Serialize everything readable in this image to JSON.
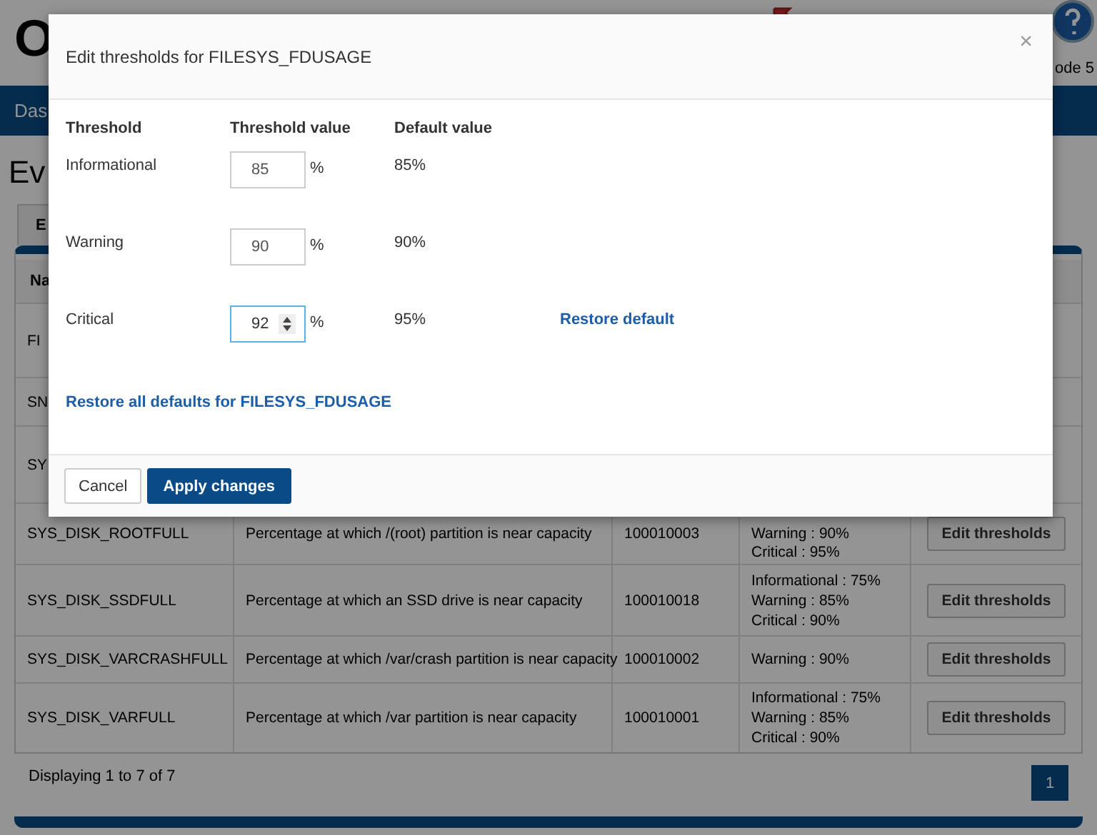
{
  "page": {
    "logo": "O",
    "node_label": "ode 5",
    "nav_item": "Das",
    "heading": "Ev",
    "tab": "E",
    "table": {
      "column_1": "Na",
      "rows": [
        {
          "name": "FI"
        },
        {
          "name": "SN"
        },
        {
          "name": "SY"
        },
        {
          "name": "SYS_DISK_ROOTFULL",
          "description": "Percentage at which /(root) partition is near capacity",
          "id": "100010003",
          "thresholds": [
            "Warning : 90%",
            "Critical : 95%"
          ],
          "action": "Edit thresholds"
        },
        {
          "name": "SYS_DISK_SSDFULL",
          "description": "Percentage at which an SSD drive is near capacity",
          "id": "100010018",
          "thresholds": [
            "Informational : 75%",
            "Warning : 85%",
            "Critical : 90%"
          ],
          "action": "Edit thresholds"
        },
        {
          "name": "SYS_DISK_VARCRASHFULL",
          "description": "Percentage at which /var/crash partition is near capacity",
          "id": "100010002",
          "thresholds": [
            "Warning : 90%"
          ],
          "action": "Edit thresholds"
        },
        {
          "name": "SYS_DISK_VARFULL",
          "description": "Percentage at which /var partition is near capacity",
          "id": "100010001",
          "thresholds": [
            "Informational : 75%",
            "Warning : 85%",
            "Critical : 90%"
          ],
          "action": "Edit thresholds"
        }
      ]
    },
    "footer": "Displaying 1 to 7 of 7",
    "pages": [
      {
        "label": "1",
        "selected": true
      }
    ]
  },
  "dialog": {
    "title": "Edit thresholds for FILESYS_FDUSAGE",
    "close": "×",
    "columns": [
      "Threshold",
      "Threshold value",
      "Default value"
    ],
    "rows": [
      {
        "label": "Informational",
        "value": "85",
        "unit": "%",
        "default": "85%",
        "focused": false
      },
      {
        "label": "Warning",
        "value": "90",
        "unit": "%",
        "default": "90%",
        "focused": false
      },
      {
        "label": "Critical",
        "value": "92",
        "unit": "%",
        "default": "95%",
        "focused": true,
        "restore": "Restore default"
      }
    ],
    "restore_all": "Restore all defaults for FILESYS_FDUSAGE",
    "buttons": {
      "cancel": "Cancel",
      "apply": "Apply changes"
    }
  }
}
